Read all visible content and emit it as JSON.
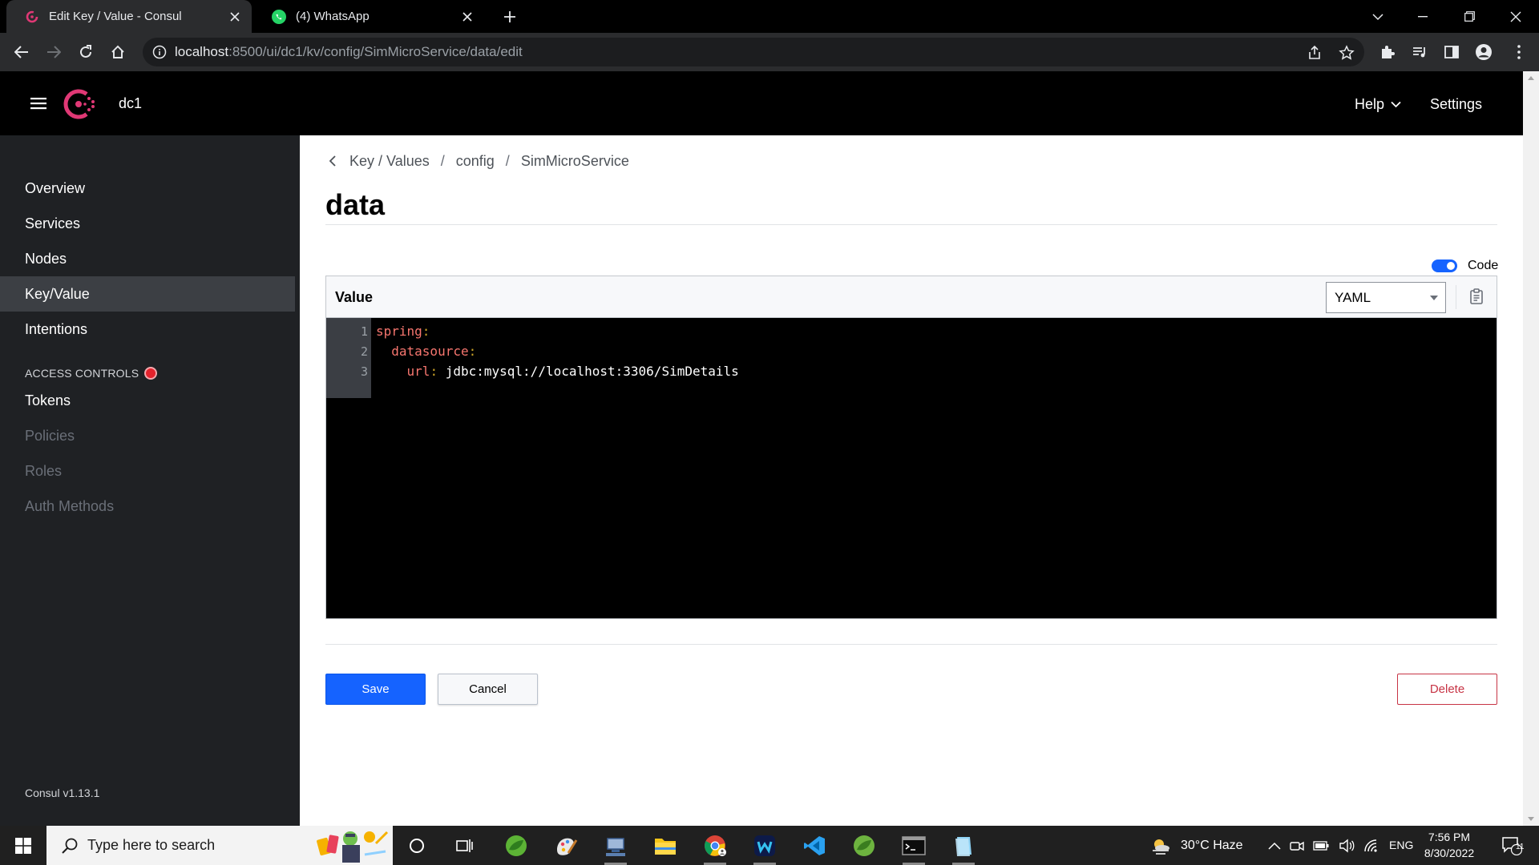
{
  "browser": {
    "tabs": [
      {
        "title": "Edit Key / Value - Consul",
        "active": true
      },
      {
        "title": "(4) WhatsApp",
        "active": false
      }
    ],
    "url_host": "localhost",
    "url_rest": ":8500/ui/dc1/kv/config/SimMicroService/data/edit"
  },
  "header": {
    "datacenter": "dc1",
    "help": "Help",
    "settings": "Settings"
  },
  "sidebar": {
    "items": [
      {
        "label": "Overview"
      },
      {
        "label": "Services"
      },
      {
        "label": "Nodes"
      },
      {
        "label": "Key/Value",
        "active": true
      },
      {
        "label": "Intentions"
      }
    ],
    "group_label": "ACCESS CONTROLS",
    "acl_items": [
      {
        "label": "Tokens"
      },
      {
        "label": "Policies",
        "disabled": true
      },
      {
        "label": "Roles",
        "disabled": true
      },
      {
        "label": "Auth Methods",
        "disabled": true
      }
    ],
    "version": "Consul v1.13.1"
  },
  "main": {
    "breadcrumbs": [
      "Key / Values",
      "config",
      "SimMicroService"
    ],
    "title": "data",
    "code_toggle_label": "Code",
    "value_label": "Value",
    "language": "YAML",
    "code_lines": [
      {
        "num": "1",
        "indent": "",
        "key": "spring",
        "value": ""
      },
      {
        "num": "2",
        "indent": "  ",
        "key": "datasource",
        "value": ""
      },
      {
        "num": "3",
        "indent": "    ",
        "key": "url",
        "value": "jdbc:mysql://localhost:3306/SimDetails"
      }
    ],
    "save": "Save",
    "cancel": "Cancel",
    "delete": "Delete"
  },
  "taskbar": {
    "search_placeholder": "Type here to search",
    "weather": "30°C  Haze",
    "language": "ENG",
    "time": "7:56 PM",
    "date": "8/30/2022",
    "notifications": "11"
  },
  "colors": {
    "consul_brand": "#e03875",
    "primary_button": "#1563ff",
    "danger": "#c73445",
    "sidebar_bg": "#1f2124"
  }
}
